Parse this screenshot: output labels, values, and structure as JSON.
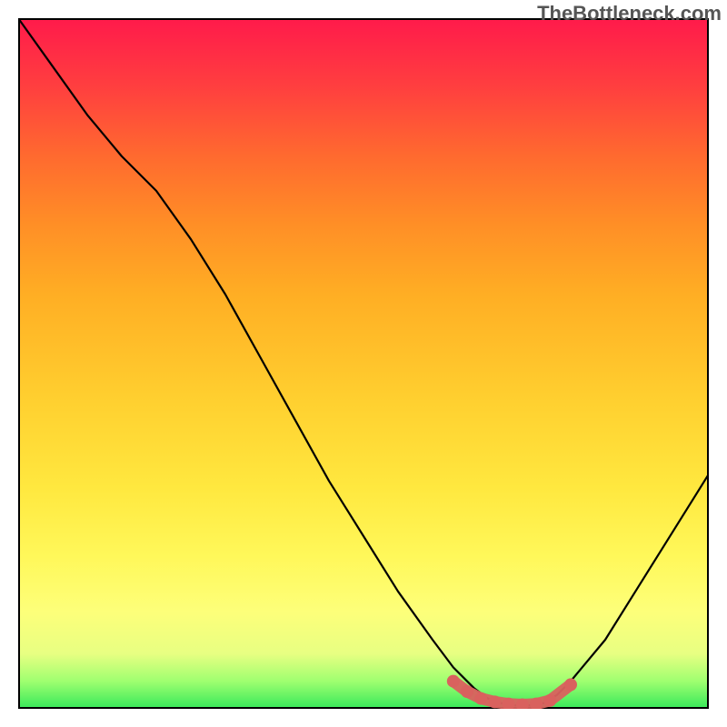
{
  "watermark": "TheBottleneck.com",
  "chart_data": {
    "type": "line",
    "title": "",
    "xlabel": "",
    "ylabel": "",
    "xlim": [
      0,
      100
    ],
    "ylim": [
      0,
      100
    ],
    "x": [
      0,
      5,
      10,
      15,
      20,
      25,
      30,
      35,
      40,
      45,
      50,
      55,
      60,
      63,
      66,
      68,
      70,
      72,
      74,
      76,
      78,
      80,
      85,
      90,
      95,
      100
    ],
    "values": [
      100,
      93,
      86,
      80,
      75,
      68,
      60,
      51,
      42,
      33,
      25,
      17,
      10,
      6,
      3,
      1.5,
      0.8,
      0.5,
      0.5,
      0.8,
      2,
      4,
      10,
      18,
      26,
      34
    ],
    "markers": {
      "x": [
        63,
        65,
        67,
        69,
        71,
        73,
        75,
        77,
        80
      ],
      "y": [
        4.0,
        2.5,
        1.5,
        1.0,
        0.7,
        0.6,
        0.7,
        1.2,
        3.5
      ]
    },
    "colors": {
      "line": "#000000",
      "marker": "#d9615e",
      "gradient_top": "#ff1a4b",
      "gradient_bottom": "#36e85a"
    }
  }
}
